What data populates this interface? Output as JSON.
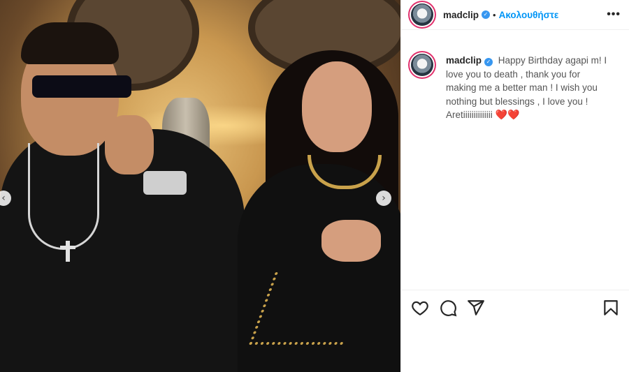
{
  "post": {
    "username": "madclip",
    "follow_label": "Ακολουθήστε",
    "dot": "•",
    "more_label": "•••",
    "verified_label": "✓",
    "caption": {
      "username": "madclip",
      "text": "Happy Birthday agapi m! I love you to death , thank you for making me a better man ! I wish you nothing but blessings , I love you ! Aretiiiiiiiiiiiiii",
      "emoji": "❤️❤️"
    },
    "carousel": {
      "prev": "‹",
      "next": "›"
    },
    "icons": [
      "heart-icon",
      "comment-icon",
      "share-icon",
      "bookmark-icon"
    ],
    "colors": {
      "verified": "#3897f0",
      "follow": "#0095f6",
      "heart": "#e0252f"
    }
  }
}
